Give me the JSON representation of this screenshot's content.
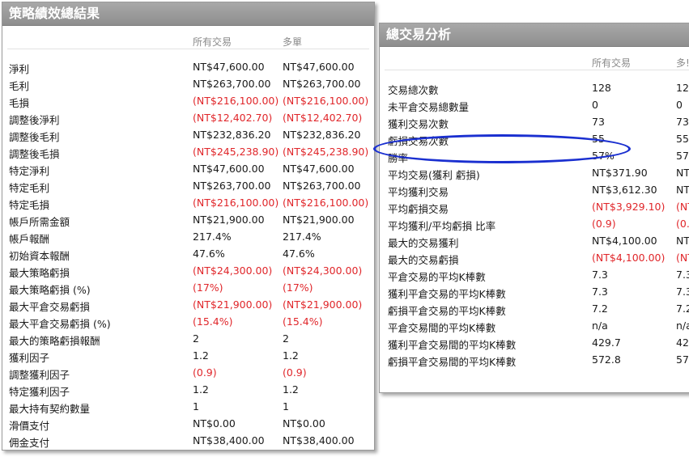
{
  "left_panel": {
    "title": "策略績效總結果",
    "columns": [
      "所有交易",
      "多單"
    ],
    "rows": [
      {
        "label": "淨利",
        "all": "NT$47,600.00",
        "long": "NT$47,600.00",
        "neg": false
      },
      {
        "label": "毛利",
        "all": "NT$263,700.00",
        "long": "NT$263,700.00",
        "neg": false
      },
      {
        "label": "毛損",
        "all": "(NT$216,100.00)",
        "long": "(NT$216,100.00)",
        "neg": true
      },
      {
        "label": "調整後淨利",
        "all": "(NT$12,402.70)",
        "long": "(NT$12,402.70)",
        "neg": true
      },
      {
        "label": "調整後毛利",
        "all": "NT$232,836.20",
        "long": "NT$232,836.20",
        "neg": false
      },
      {
        "label": "調整後毛損",
        "all": "(NT$245,238.90)",
        "long": "(NT$245,238.90)",
        "neg": true
      },
      {
        "label": "特定淨利",
        "all": "NT$47,600.00",
        "long": "NT$47,600.00",
        "neg": false
      },
      {
        "label": "特定毛利",
        "all": "NT$263,700.00",
        "long": "NT$263,700.00",
        "neg": false
      },
      {
        "label": "特定毛損",
        "all": "(NT$216,100.00)",
        "long": "(NT$216,100.00)",
        "neg": true
      },
      {
        "label": "帳戶所需金額",
        "all": "NT$21,900.00",
        "long": "NT$21,900.00",
        "neg": false
      },
      {
        "label": "帳戶報酬",
        "all": "217.4%",
        "long": "217.4%",
        "neg": false
      },
      {
        "label": "初始資本報酬",
        "all": "47.6%",
        "long": "47.6%",
        "neg": false
      },
      {
        "label": "最大策略虧損",
        "all": "(NT$24,300.00)",
        "long": "(NT$24,300.00)",
        "neg": true
      },
      {
        "label": "最大策略虧損 (%)",
        "all": "(17%)",
        "long": "(17%)",
        "neg": true
      },
      {
        "label": "最大平倉交易虧損",
        "all": "(NT$21,900.00)",
        "long": "(NT$21,900.00)",
        "neg": true
      },
      {
        "label": "最大平倉交易虧損 (%)",
        "all": "(15.4%)",
        "long": "(15.4%)",
        "neg": true
      },
      {
        "label": "最大的策略虧損報酬",
        "all": "2",
        "long": "2",
        "neg": false
      },
      {
        "label": "獲利因子",
        "all": "1.2",
        "long": "1.2",
        "neg": false
      },
      {
        "label": "調整獲利因子",
        "all": "(0.9)",
        "long": "(0.9)",
        "neg": true
      },
      {
        "label": "特定獲利因子",
        "all": "1.2",
        "long": "1.2",
        "neg": false
      },
      {
        "label": "最大持有契約數量",
        "all": "1",
        "long": "1",
        "neg": false
      },
      {
        "label": "滑價支付",
        "all": "NT$0.00",
        "long": "NT$0.00",
        "neg": false
      },
      {
        "label": "佣金支付",
        "all": "NT$38,400.00",
        "long": "NT$38,400.00",
        "neg": false
      }
    ]
  },
  "right_panel": {
    "title": "總交易分析",
    "columns": [
      "所有交易",
      "多!"
    ],
    "rows": [
      {
        "label": "交易總次數",
        "all": "128",
        "long": "12",
        "neg": false
      },
      {
        "label": "未平倉交易總數量",
        "all": "0",
        "long": "0",
        "neg": false
      },
      {
        "label": "獲利交易次數",
        "all": "73",
        "long": "73",
        "neg": false
      },
      {
        "label": "虧損交易次數",
        "all": "55",
        "long": "55",
        "neg": false
      },
      {
        "label": "勝率",
        "all": "57%",
        "long": "57",
        "neg": false
      },
      {
        "label": "平均交易(獲利 虧損)",
        "all": "NT$371.90",
        "long": "NT",
        "neg": false
      },
      {
        "label": "平均獲利交易",
        "all": "NT$3,612.30",
        "long": "NT",
        "neg": false
      },
      {
        "label": "平均虧損交易",
        "all": "(NT$3,929.10)",
        "long": "(NT",
        "neg": true
      },
      {
        "label": "平均獲利/平均虧損 比率",
        "all": "(0.9)",
        "long": "(0.",
        "neg": true
      },
      {
        "label": "最大的交易獲利",
        "all": "NT$4,100.00",
        "long": "NT",
        "neg": false
      },
      {
        "label": "最大的交易虧損",
        "all": "(NT$4,100.00)",
        "long": "(NT",
        "neg": true
      },
      {
        "label": "平倉交易的平均K棒數",
        "all": "7.3",
        "long": "7.3",
        "neg": false
      },
      {
        "label": "獲利平倉交易的平均K棒數",
        "all": "7.3",
        "long": "7.3",
        "neg": false
      },
      {
        "label": "虧損平倉交易的平均K棒數",
        "all": "7.2",
        "long": "7.2",
        "neg": false
      },
      {
        "label": "平倉交易間的平均K棒數",
        "all": "n/a",
        "long": "n/a",
        "neg": false
      },
      {
        "label": "獲利平倉交易間的平均K棒數",
        "all": "429.7",
        "long": "42",
        "neg": false
      },
      {
        "label": "虧損平倉交易間的平均K棒數",
        "all": "572.8",
        "long": "57",
        "neg": false
      }
    ]
  },
  "colors": {
    "negative": "#e0262a",
    "highlight": "#1a2fd0",
    "title_bar": "#999999"
  }
}
